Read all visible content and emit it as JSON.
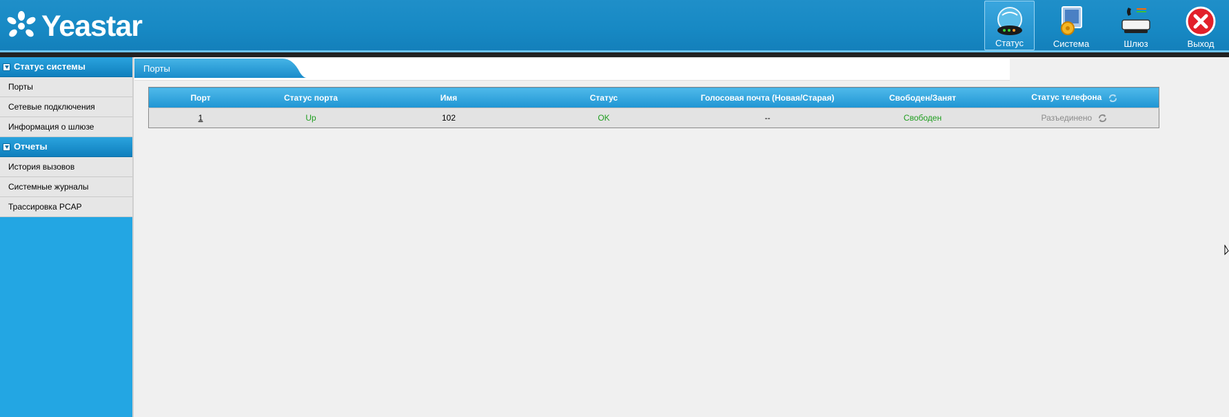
{
  "header": {
    "brand": "Yeastar",
    "nav": [
      {
        "label": "Статус",
        "icon": "status-globe-icon",
        "active": true
      },
      {
        "label": "Система",
        "icon": "system-settings-icon",
        "active": false
      },
      {
        "label": "Шлюз",
        "icon": "gateway-phone-icon",
        "active": false
      },
      {
        "label": "Выход",
        "icon": "logout-close-icon",
        "active": false
      }
    ]
  },
  "sidebar": {
    "sections": [
      {
        "title": "Статус системы",
        "items": [
          "Порты",
          "Сетевые подключения",
          "Информация о шлюзе"
        ]
      },
      {
        "title": "Отчеты",
        "items": [
          "История вызовов",
          "Системные журналы",
          "Трассировка PCAP"
        ]
      }
    ]
  },
  "content": {
    "tab": "Порты",
    "table": {
      "headers": [
        "Порт",
        "Статус порта",
        "Имя",
        "Статус",
        "Голосовая почта (Новая/Старая)",
        "Свободен/Занят",
        "Статус телефона"
      ],
      "rows": [
        [
          "1",
          "Up",
          "102",
          "OK",
          "--",
          "Свободен",
          "Разъединено"
        ]
      ]
    }
  },
  "colors": {
    "header_blue": "#1789c4",
    "sidebar_blue": "#23a6e3",
    "status_green": "#1e9e1e",
    "muted_grey": "#8a8a8a"
  }
}
